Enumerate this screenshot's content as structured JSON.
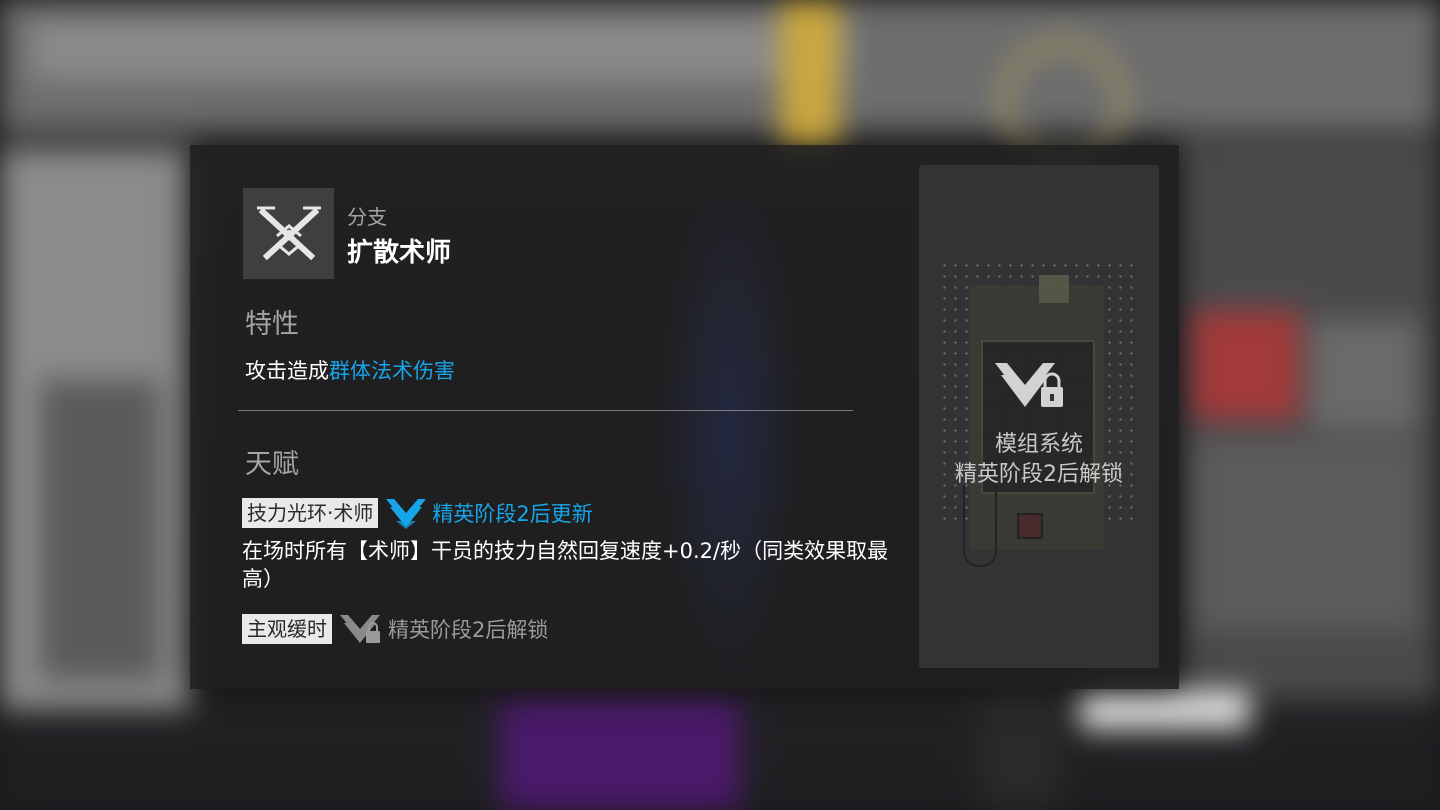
{
  "branch": {
    "label": "分支",
    "name": "扩散术师",
    "icon": "splash-caster-branch-icon"
  },
  "trait": {
    "title": "特性",
    "text_prefix": "攻击造成",
    "text_highlight": "群体法术伤害"
  },
  "talents": {
    "title": "天赋",
    "items": [
      {
        "name": "技力光环·术师",
        "status": "精英阶段2后更新",
        "description": "在场时所有【术师】干员的技力自然回复速度+0.2/秒（同类效果取最高）"
      },
      {
        "name": "主观缓时",
        "status": "精英阶段2后解锁"
      }
    ]
  },
  "module": {
    "title": "模组系统",
    "subtitle": "精英阶段2后解锁"
  },
  "colors": {
    "highlight": "#16a5e8",
    "panel": "#1e1e1f",
    "tag_bg": "#e9e9e9"
  }
}
